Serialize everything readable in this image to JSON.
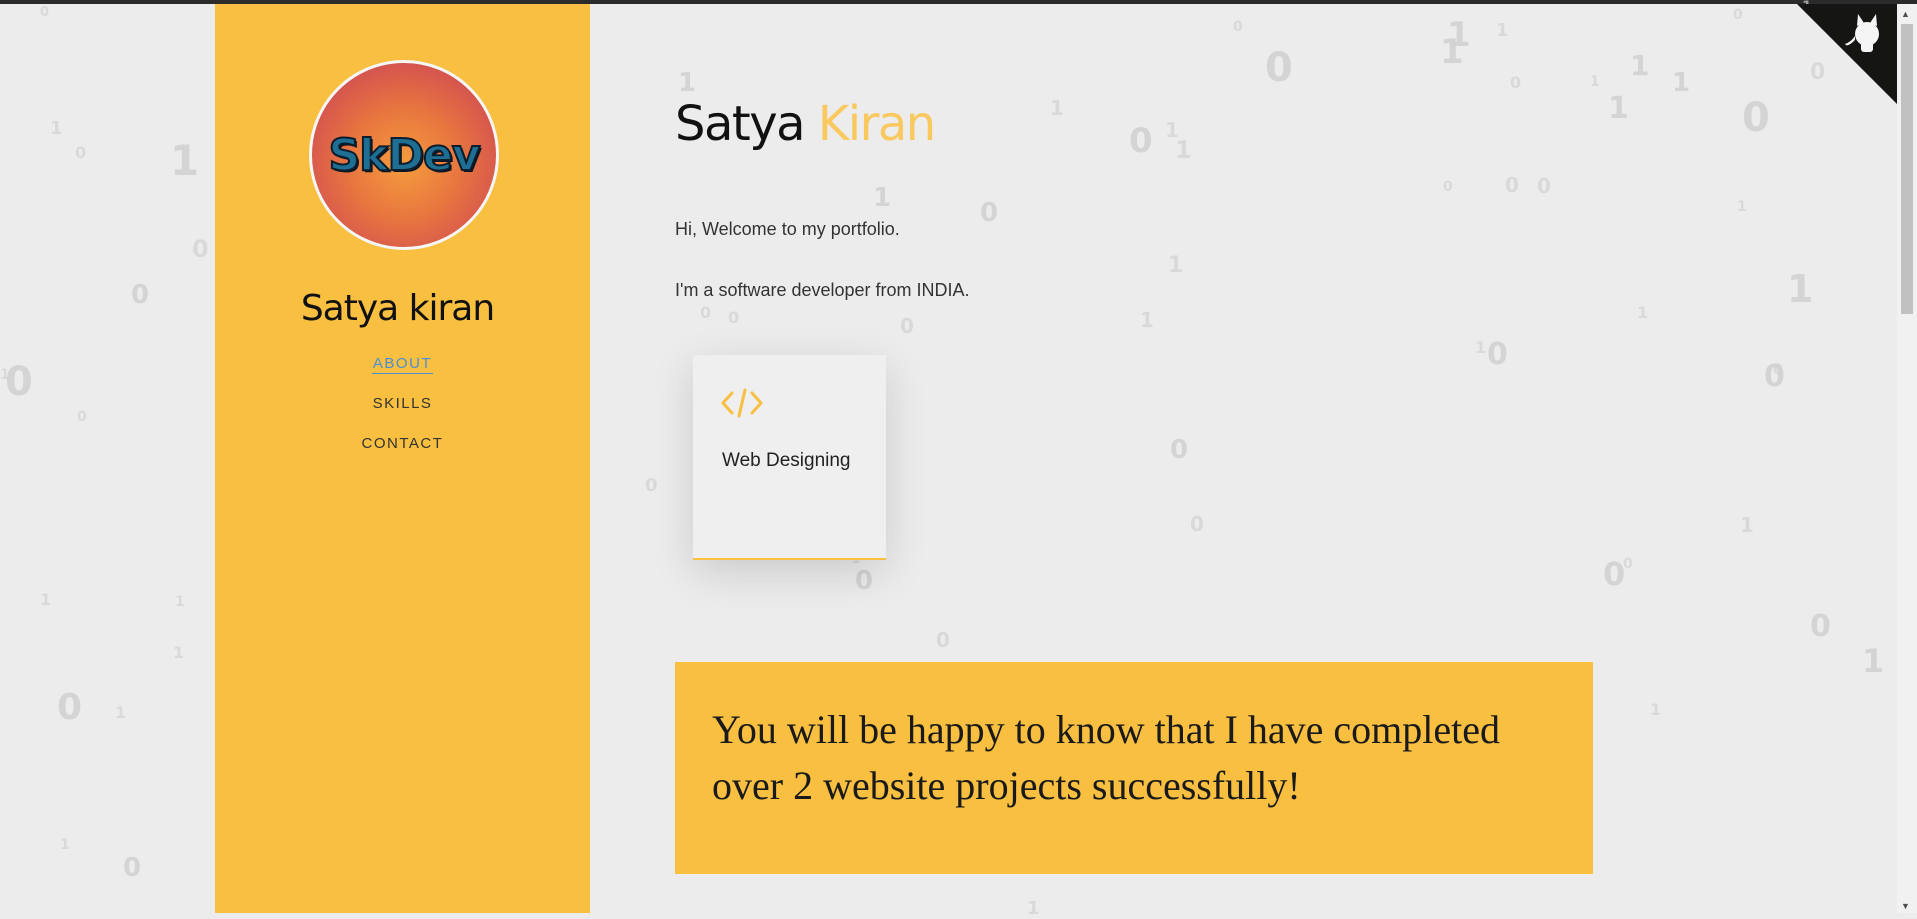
{
  "sidebar": {
    "logo_text": "SkDev",
    "name": "Satya kiran",
    "nav": [
      {
        "label": "ABOUT",
        "active": true
      },
      {
        "label": "SKILLS",
        "active": false
      },
      {
        "label": "CONTACT",
        "active": false
      }
    ]
  },
  "main": {
    "title_first": "Satya",
    "title_last": "Kiran",
    "intro_line1": "Hi, Welcome to my portfolio.",
    "intro_line2": "I'm a software developer from INDIA.",
    "service_card": {
      "icon": "code-icon",
      "label": "Web Designing"
    },
    "banner_text": "You will be happy to know that I have completed over 2 website projects successfully!"
  },
  "corner": {
    "icon": "github-octocat-icon"
  },
  "colors": {
    "accent": "#f8bf40",
    "accent_light": "#f9c85e",
    "active_link": "#4a8fd6",
    "background": "#ececec"
  },
  "background_digits": [
    "0",
    "1"
  ]
}
